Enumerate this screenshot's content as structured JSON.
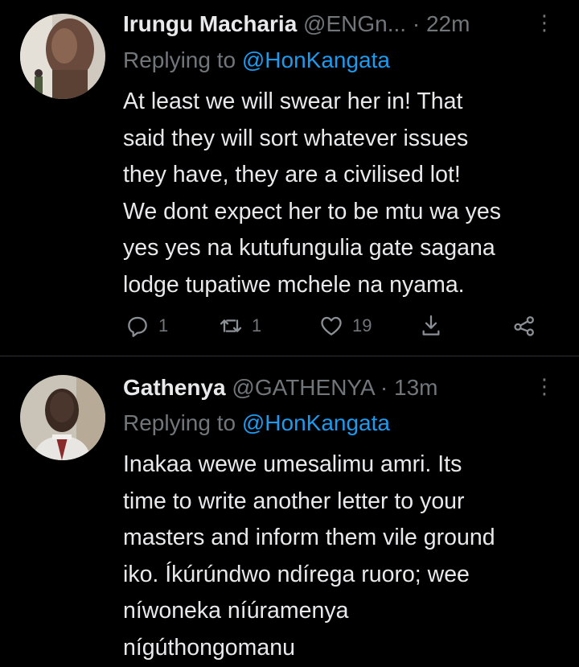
{
  "tweets": [
    {
      "author_name": "Irungu Macharia",
      "handle": "@ENGn...",
      "separator": "·",
      "time": "22m",
      "menu_icon": "more-vertical-icon",
      "replying_prefix": "Replying to",
      "replying_to": "@HonKangata",
      "body_lines": [
        "At least we will swear her in! That",
        "said they will sort whatever issues",
        "they have, they are a civilised lot!",
        "We dont expect her to be mtu wa yes",
        "yes yes na kutufungulia gate sagana",
        "lodge tupatiwe mchele na nyama."
      ],
      "replies": "1",
      "retweets": "1",
      "likes": "19"
    },
    {
      "author_name": "Gathenya",
      "handle": "@GATHENYA",
      "separator": "·",
      "time": "13m",
      "menu_icon": "more-vertical-icon",
      "replying_prefix": "Replying to",
      "replying_to": "@HonKangata",
      "body_lines": [
        "Inakaa wewe umesalimu amri. Its",
        "time to write another letter to your",
        "masters and inform them vile ground",
        "iko. Íkúrúndwo ndírega ruoro; wee",
        "níwoneka níúramenya",
        "nígúthongomanu"
      ]
    }
  ],
  "colors": {
    "background": "#000000",
    "text": "#e7e9ea",
    "muted": "#71767b",
    "link": "#1d9bf0",
    "divider": "#2f3336"
  }
}
